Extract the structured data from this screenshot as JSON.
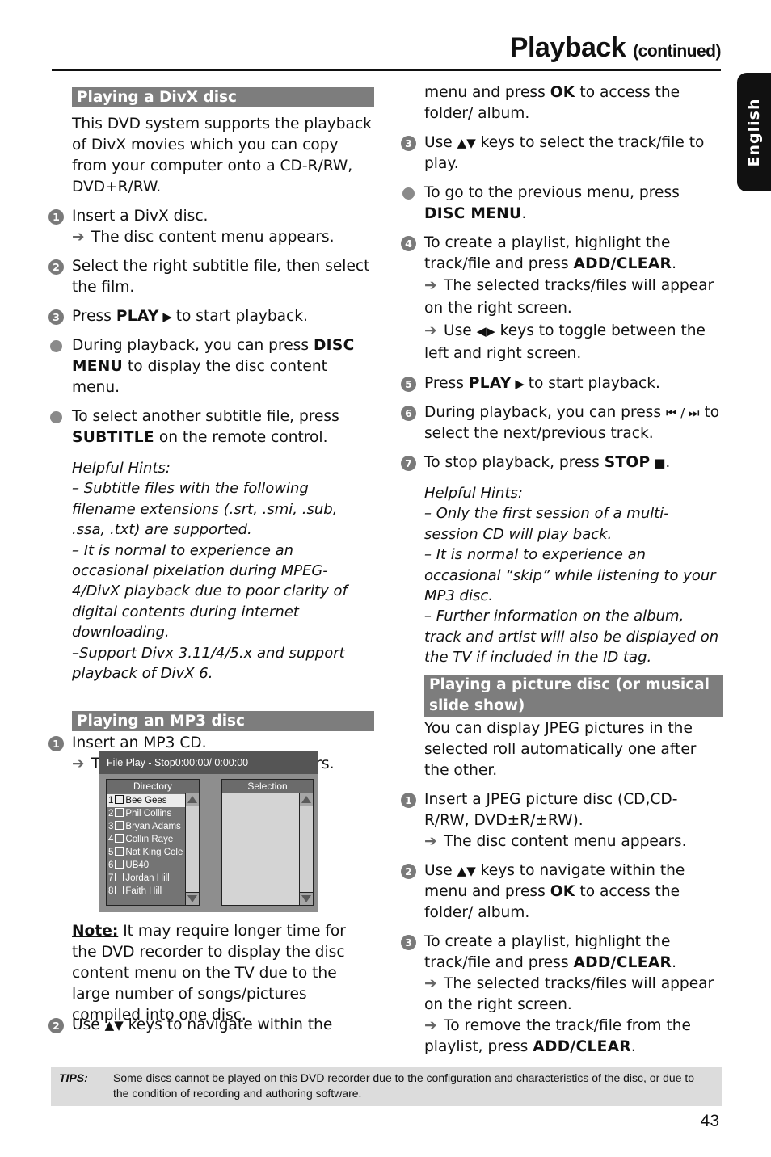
{
  "header": {
    "title": "Playback",
    "subtitle": "(continued)",
    "language_tab": "English"
  },
  "divx": {
    "heading": "Playing a DivX disc",
    "intro": "This DVD system supports the playback of DivX movies which you can copy from your computer onto a CD-R/RW, DVD+R/RW.",
    "steps": [
      {
        "num": "1",
        "text": "Insert a DivX disc.",
        "result": "The disc content menu appears."
      },
      {
        "num": "2",
        "text": "Select the right subtitle file, then select the film."
      },
      {
        "num": "3",
        "pre": "Press ",
        "bold": "PLAY",
        "glyph": " ▶ ",
        "post": "to start playback."
      }
    ],
    "bullets": [
      {
        "pre": "During playback, you can press ",
        "bold": "DISC MENU",
        "post": " to display the disc content menu."
      },
      {
        "pre": "To select another subtitle file, press ",
        "bold": "SUBTITLE",
        "post": " on the remote control."
      }
    ],
    "hints_title": "Helpful Hints:",
    "hints": [
      "– Subtitle files with the following filename extensions (.srt, .smi, .sub, .ssa, .txt) are supported.",
      "– It is normal to experience an occasional pixelation during MPEG-4/DivX playback due to poor clarity of digital contents during internet downloading.",
      "–Support Divx 3.11/4/5.x and support playback of DivX 6."
    ]
  },
  "mp3": {
    "heading": "Playing an MP3 disc",
    "step1": {
      "num": "1",
      "text": "Insert an MP3 CD.",
      "result": "The disc content menu appears."
    },
    "screen": {
      "status": "File Play - Stop0:00:00/ 0:00:00",
      "directory_label": "Directory",
      "selection_label": "Selection",
      "items": [
        {
          "n": "1",
          "name": "Bee Gees",
          "selected": true
        },
        {
          "n": "2",
          "name": "Phil Collins"
        },
        {
          "n": "3",
          "name": "Bryan Adams"
        },
        {
          "n": "4",
          "name": "Collin Raye"
        },
        {
          "n": "5",
          "name": "Nat King Cole"
        },
        {
          "n": "6",
          "name": "UB40"
        },
        {
          "n": "7",
          "name": "Jordan Hill"
        },
        {
          "n": "8",
          "name": "Faith Hill"
        }
      ]
    },
    "note_label": "Note:",
    "note_text": " It may require longer time for the DVD recorder to display the disc content menu on the TV due to the large number of songs/pictures compiled into one disc.",
    "step2": {
      "num": "2",
      "pre": "Use ",
      "glyph": "▲▼",
      "post": " keys to navigate within the"
    },
    "step2_cont": {
      "pre": "menu and press ",
      "bold": "OK",
      "post": " to access the folder/ album."
    },
    "step3": {
      "num": "3",
      "pre": "Use ",
      "glyph": "▲▼",
      "post": " keys to select the track/file to play."
    },
    "bullet": {
      "pre": "To go to the previous menu, press ",
      "bold": "DISC MENU",
      "post": "."
    },
    "step4": {
      "num": "4",
      "pre": "To create a playlist, highlight the track/file and press ",
      "bold": "ADD/CLEAR",
      "post": ".",
      "results": [
        "The selected tracks/files will appear on the right screen."
      ],
      "result2_pre": "Use ",
      "result2_glyph": "◀▶",
      "result2_post": " keys to toggle between the left and right screen."
    },
    "step5": {
      "num": "5",
      "pre": "Press ",
      "bold": "PLAY",
      "glyph": " ▶ ",
      "post": "to start playback."
    },
    "step6": {
      "num": "6",
      "pre": "During playback, you can press ",
      "glyph": "⏮ / ⏭",
      "post": " to select the next/previous track."
    },
    "step7": {
      "num": "7",
      "pre": "To stop playback, press ",
      "bold": "STOP",
      "glyph": " ■",
      "post": "."
    },
    "hints_title": "Helpful Hints:",
    "hints": [
      "–  Only the first session of a multi-session CD will play back.",
      "–  It is normal to experience an occasional “skip” while listening to your MP3 disc.",
      "–  Further information on the album, track and artist will also be displayed on the TV if included in the ID tag."
    ]
  },
  "picture": {
    "heading": "Playing a picture disc (or musical slide show)",
    "intro": "You can display JPEG pictures in the selected roll automatically one after the other.",
    "step1": {
      "num": "1",
      "text": "Insert a JPEG picture disc (CD,CD-R/RW, DVD±R/±RW).",
      "result": "The disc content menu appears."
    },
    "step2": {
      "num": "2",
      "pre": "Use ",
      "glyph": "▲▼",
      "mid": " keys to navigate within the menu and press ",
      "bold": "OK",
      "post": " to access the folder/ album."
    },
    "step3": {
      "num": "3",
      "pre": "To create a playlist, highlight the track/file and press ",
      "bold": "ADD/CLEAR",
      "post": ".",
      "result1": "The selected tracks/files will appear on the right screen.",
      "result2_pre": "To remove the track/file from the playlist, press ",
      "result2_bold": "ADD/CLEAR",
      "result2_post": "."
    }
  },
  "tips": {
    "label": "TIPS:",
    "text": "Some discs cannot be played on this DVD recorder due to the configuration and characteristics of the disc, or due to the condition of recording and authoring software."
  },
  "footer": {
    "page_number": "43"
  },
  "icons": {
    "arrow": "➔"
  }
}
